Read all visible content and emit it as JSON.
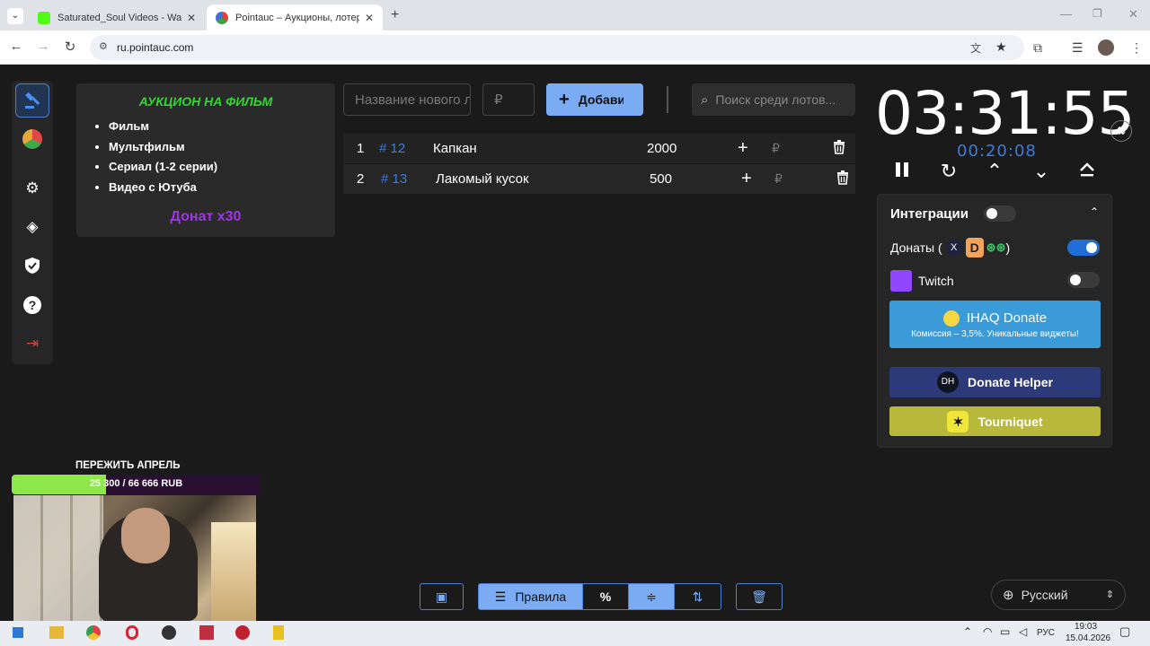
{
  "browser": {
    "tabs": [
      {
        "title": "Saturated_Soul Videos - Watch",
        "active": false
      },
      {
        "title": "Pointauc – Аукционы, лотереи",
        "active": true
      }
    ],
    "url": "ru.pointauc.com"
  },
  "rules": {
    "title": "АУКЦИОН НА ФИЛЬМ",
    "items": [
      "Фильм",
      "Мультфильм",
      "Сериал (1-2 серии)",
      "Видео с Ютуба"
    ],
    "donate": "Донат x30"
  },
  "controls": {
    "name_placeholder": "Название нового лота",
    "amount_placeholder": "₽",
    "add_label": "Добавить",
    "search_placeholder": "Поиск среди лотов..."
  },
  "lots": [
    {
      "num": "1",
      "id": "# 12",
      "name": "Капкан",
      "amount": "2000",
      "currency": "₽"
    },
    {
      "num": "2",
      "id": "# 13",
      "name": "Лакомый кусок",
      "amount": "500",
      "currency": "₽"
    }
  ],
  "timer": {
    "main": "03:31:55",
    "sub": "00:20:08"
  },
  "integrations": {
    "title": "Интеграции",
    "enabled": false,
    "donations_label": "Донаты (",
    "donations_close": ")",
    "donations_enabled": true,
    "twitch_label": "Twitch",
    "twitch_enabled": false,
    "ihaq_title": "IHAQ Donate",
    "ihaq_sub": "Комиссия – 3,5%. Уникальные виджеты!",
    "donate_helper": "Donate Helper",
    "donate_helper_logo": "DH",
    "tourniquet": "Tourniquet"
  },
  "bottom": {
    "rules_label": "Правила",
    "percent_label": "%"
  },
  "language": "Русский",
  "stream": {
    "goal_title": "ПЕРЕЖИТЬ АПРЕЛЬ",
    "goal_progress": "25 300 / 66 666 RUB",
    "goal_fraction": 0.38
  },
  "taskbar": {
    "lang": "РУС",
    "time": "19:03",
    "date": "15.04.2026"
  },
  "colors": {
    "accent": "#7aabf3",
    "lot_id": "#3e7bd8",
    "rules_title": "#34d633",
    "donate": "#9d35e6",
    "ihaq": "#3a9bd8",
    "donate_helper": "#2d3a7a",
    "tourniquet": "#b8b83a"
  }
}
